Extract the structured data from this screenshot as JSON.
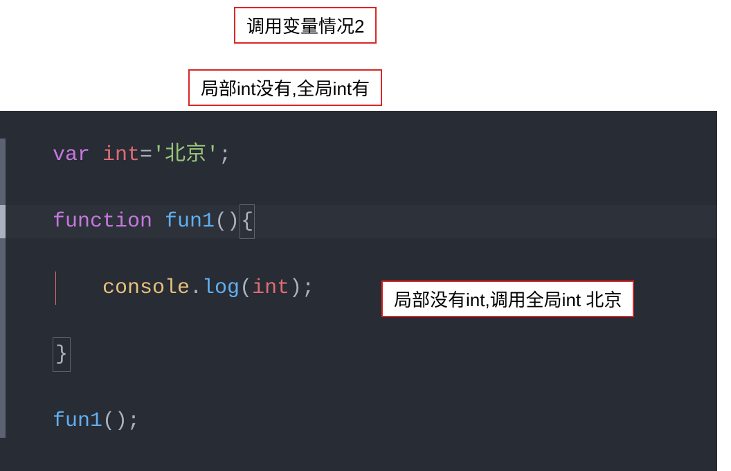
{
  "annotations": {
    "title": "调用变量情况2",
    "subtitle": "局部int没有,全局int有",
    "inline": "局部没有int,调用全局int 北京"
  },
  "code": {
    "line1": {
      "kw": "var",
      "name": "int",
      "eq": " = ",
      "str": "'北京'",
      "semi": ";"
    },
    "line3": {
      "kw": "function",
      "name": "fun1",
      "parens": "()",
      "brace": "{"
    },
    "line5": {
      "obj": "console",
      "dot": ".",
      "method": "log",
      "open": "(",
      "arg": "int",
      "close": ");"
    },
    "line7": {
      "brace": "}"
    },
    "line9": {
      "call": "fun1",
      "parens": "();"
    }
  }
}
